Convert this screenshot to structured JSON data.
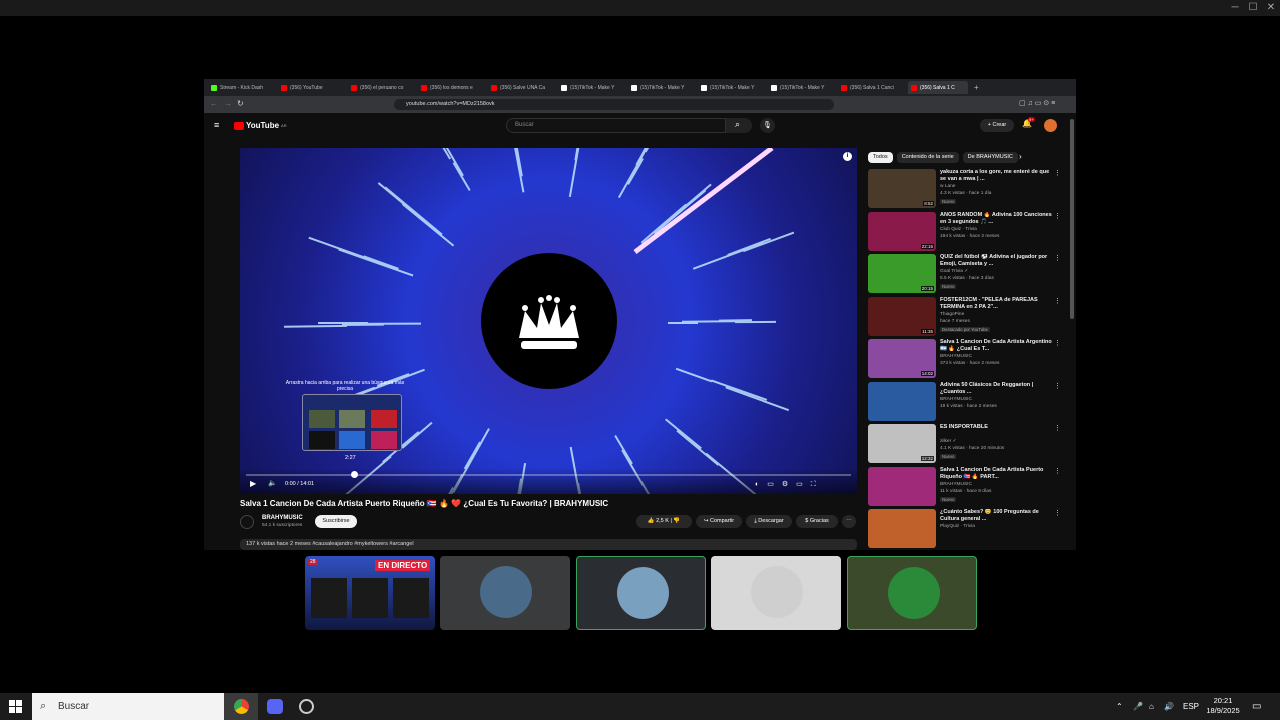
{
  "browser": {
    "tabs": [
      {
        "label": "Stream - Kick Dash",
        "color": "#53fc18"
      },
      {
        "label": "(356) YouTube",
        "color": "#ff0000"
      },
      {
        "label": "(356) el peruano co",
        "color": "#ff0000"
      },
      {
        "label": "(356) los demons e",
        "color": "#ff0000"
      },
      {
        "label": "(356) Salve UNA Ca",
        "color": "#ff0000"
      },
      {
        "label": "(15)TikTok - Make Y",
        "color": "#ffffff"
      },
      {
        "label": "(15)TikTok - Make Y",
        "color": "#ffffff"
      },
      {
        "label": "(15)TikTok - Make Y",
        "color": "#ffffff"
      },
      {
        "label": "(15)TikTok - Make Y",
        "color": "#ffffff"
      },
      {
        "label": "(356) Salva 1 Canci",
        "color": "#ff0000"
      },
      {
        "label": "(356) Salva 1 C",
        "color": "#ff0000",
        "active": true
      }
    ],
    "url": "youtube.com/watch?v=MDz2158ovk"
  },
  "youtube": {
    "logo": "YouTube",
    "logo_region": "AR",
    "search_placeholder": "Buscar",
    "create_label": "Crear",
    "notif_count": "9+",
    "player": {
      "overlay_text": "Arrastra hacia arriba para realizar una búsqueda más precisa",
      "hover_time": "2:27",
      "time_display": "0:00 / 14:01",
      "progress": 0.0
    },
    "video_title": "Salva 1 Cancion De Cada Artista Puerto Riqueño 🇵🇷 🔥 ❤️ ¿Cual Es Tu Favorita? | BRAHYMUSIC",
    "channel_name": "BRAHYMUSIC",
    "subscribers": "54.1 k suscriptores",
    "subscribe_label": "Suscribirse",
    "likes": "2,5 K",
    "share_label": "Compartir",
    "download_label": "Descargar",
    "thanks_label": "Gracias",
    "description": "137 k vistas  hace 2 meses  #causaleajandro #mykeltowers #arcangel",
    "chips": [
      "Todos",
      "Contenido de la serie",
      "De BRAHYMUSIC"
    ],
    "recommendations": [
      {
        "title": "yakuza corta a los gore, me enteré de que se van a mwa | ...",
        "channel": "w Lane",
        "meta": "4.3 K vistas · hace 1 día",
        "badge": "Nuevo",
        "duration": "8:52",
        "thumb": "#4a3a2a"
      },
      {
        "title": "AÑOS RANDOM 🔥 Adivina 100 Canciones en 3 segundos 🎵 ...",
        "channel": "Club Quiz · Trivia",
        "meta": "194 k vistas · hace 2 meses",
        "badge": "",
        "duration": "22:16",
        "thumb": "#8a1a4a"
      },
      {
        "title": "QUIZ del fútbol ⚽ Adivina el jugador por Emoji, Camiseta y ...",
        "channel": "Goal Trivia ✓",
        "meta": "5.5 K vistas · hace 3 días",
        "badge": "Nuevo",
        "duration": "20:15",
        "thumb": "#3a9a2a"
      },
      {
        "title": "FOSTER12CM - \"PELEA de PAREJAS TERMINA en 2 PA 2\"...",
        "channel": "ThiagoPine",
        "meta": "hace 7 meses",
        "badge": "Destacado por YouTube",
        "duration": "11:35",
        "thumb": "#5a1a1a"
      },
      {
        "title": "Salva 1 Cancion De Cada Artista Argentino 🇦🇷 🔥 ¿Cual Es T...",
        "channel": "BRAHYMUSIC",
        "meta": "373 k vistas · hace 2 meses",
        "badge": "",
        "duration": "14:02",
        "thumb": "#8a4aa0"
      },
      {
        "title": "Adivina 50 Clásicos De Reggaeton | ¿Cuantos ...",
        "channel": "BRAHYMUSIC",
        "meta": "19 k vistas · hace 2 meses",
        "badge": "",
        "duration": "",
        "thumb": "#2a5aa0"
      },
      {
        "title": "ES INSPORTABLE",
        "channel": "zilker ✓",
        "meta": "4.1 K vistas · hace 20 minutos",
        "badge": "Nuevo",
        "duration": "12:32",
        "thumb": "#c0c0c0"
      },
      {
        "title": "Salva 1 Cancion De Cada Artista Puerto Riqueño 🇵🇷 🔥 PART...",
        "channel": "BRAHYMUSIC",
        "meta": "11 k vistas · hace 8 días",
        "badge": "Nuevo",
        "duration": "",
        "thumb": "#a02a7a"
      },
      {
        "title": "¿Cuánto Sabes? 😊 100 Preguntas de Cultura general ...",
        "channel": "PlayQuiz · Trivia",
        "meta": "",
        "badge": "",
        "duration": "",
        "thumb": "#c0602a"
      }
    ]
  },
  "participants": [
    {
      "name": "stream-tile",
      "live_label": "EN DIRECTO",
      "viewers": "28"
    },
    {
      "name": "participant-1",
      "avatar": "#4a6a8a"
    },
    {
      "name": "participant-2",
      "avatar": "#7aa0c0",
      "bg": "#2a2d31",
      "speaking": true
    },
    {
      "name": "participant-3",
      "avatar": "#cfcfcf",
      "bg": "#d8d8d8"
    },
    {
      "name": "participant-4",
      "avatar": "#2a8a3a",
      "bg": "#3a4a2a",
      "speaking": true
    }
  ],
  "taskbar": {
    "search_placeholder": "Buscar",
    "language": "ESP",
    "time": "20:21",
    "date": "18/9/2025"
  }
}
